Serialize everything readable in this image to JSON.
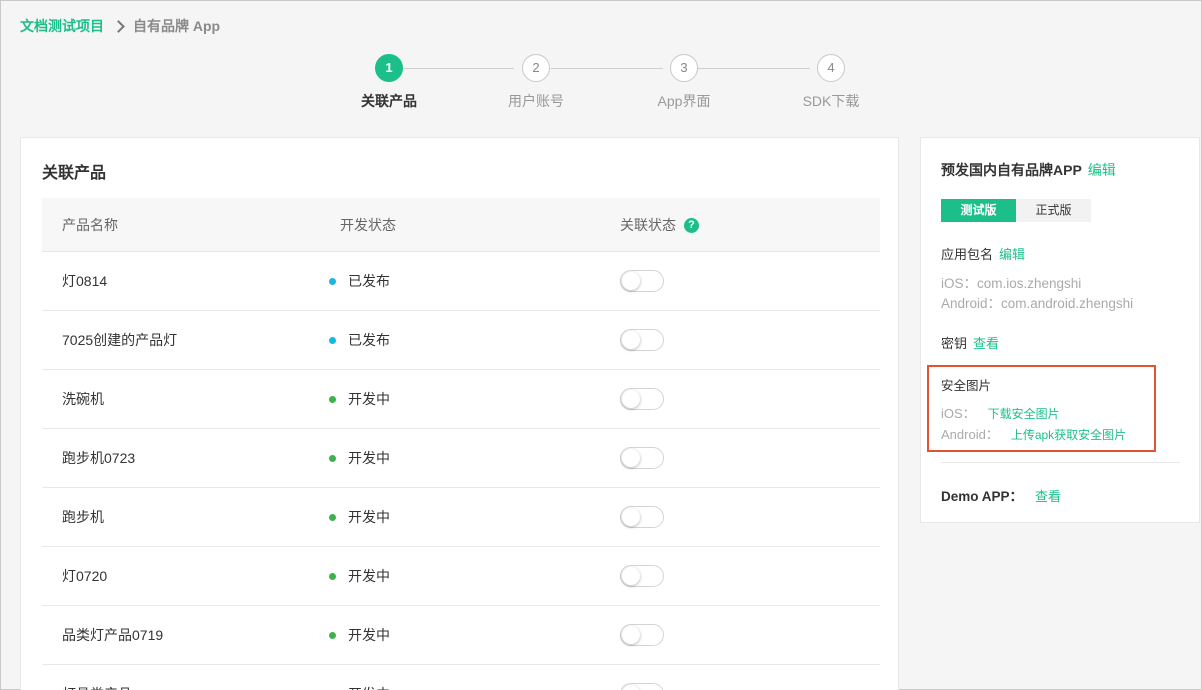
{
  "breadcrumb": {
    "project": "文档测试项目",
    "current": "自有品牌 App"
  },
  "steps": [
    {
      "number": "1",
      "label": "关联产品",
      "active": true
    },
    {
      "number": "2",
      "label": "用户账号",
      "active": false
    },
    {
      "number": "3",
      "label": "App界面",
      "active": false
    },
    {
      "number": "4",
      "label": "SDK下载",
      "active": false
    }
  ],
  "main": {
    "title": "关联产品",
    "columns": [
      "产品名称",
      "开发状态",
      "关联状态"
    ],
    "help_icon": "?",
    "rows": [
      {
        "name": "灯0814",
        "status": "已发布",
        "status_color": "#1ab5e0",
        "linked": false
      },
      {
        "name": "7025创建的产品灯",
        "status": "已发布",
        "status_color": "#1ab5e0",
        "linked": false
      },
      {
        "name": "洗碗机",
        "status": "开发中",
        "status_color": "#3cb34a",
        "linked": false
      },
      {
        "name": "跑步机0723",
        "status": "开发中",
        "status_color": "#3cb34a",
        "linked": false
      },
      {
        "name": "跑步机",
        "status": "开发中",
        "status_color": "#3cb34a",
        "linked": false
      },
      {
        "name": "灯0720",
        "status": "开发中",
        "status_color": "#3cb34a",
        "linked": false
      },
      {
        "name": "品类灯产品0719",
        "status": "开发中",
        "status_color": "#3cb34a",
        "linked": false
      },
      {
        "name": "灯具类产品",
        "status": "开发中",
        "status_color": "#3cb34a",
        "linked": false
      }
    ]
  },
  "side": {
    "title": "预发国内自有品牌APP",
    "title_edit": "编辑",
    "tabs": [
      "测试版",
      "正式版"
    ],
    "package_label": "应用包名",
    "package_edit": "编辑",
    "ios_package": "iOS：com.ios.zhengshi",
    "android_package": "Android：com.android.zhengshi",
    "key_label": "密钥",
    "key_view": "查看",
    "safe_image": {
      "title": "安全图片",
      "ios_label": "iOS：",
      "ios_link": "下载安全图片",
      "android_label": "Android：",
      "android_link": "上传apk获取安全图片"
    },
    "demo_label": "Demo APP：",
    "demo_view": "查看"
  },
  "colors": {
    "accent": "#1cbf8a",
    "highlight_box": "#e0542f"
  }
}
